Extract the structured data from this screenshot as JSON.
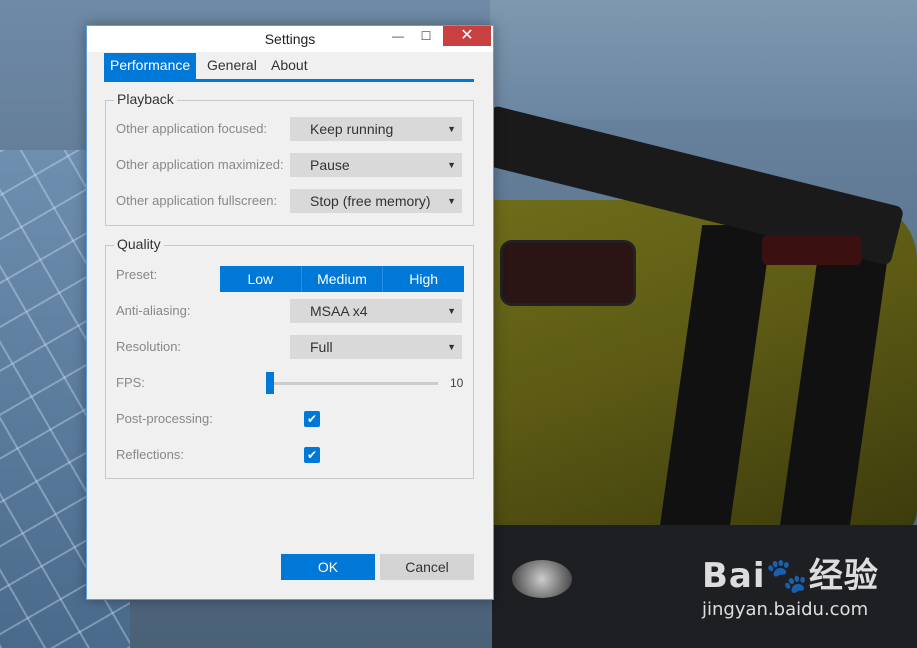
{
  "window": {
    "title": "Settings",
    "minimize_icon": "minimize-icon",
    "maximize_icon": "maximize-icon",
    "close_icon": "close-icon"
  },
  "tabs": [
    {
      "label": "Performance",
      "active": true
    },
    {
      "label": "General",
      "active": false
    },
    {
      "label": "About",
      "active": false
    }
  ],
  "playback": {
    "title": "Playback",
    "rows": [
      {
        "label": "Other application focused:",
        "value": "Keep running"
      },
      {
        "label": "Other application maximized:",
        "value": "Pause"
      },
      {
        "label": "Other application fullscreen:",
        "value": "Stop (free memory)"
      }
    ]
  },
  "quality": {
    "title": "Quality",
    "preset_label": "Preset:",
    "preset_options": [
      "Low",
      "Medium",
      "High"
    ],
    "antialiasing_label": "Anti-aliasing:",
    "antialiasing_value": "MSAA x4",
    "resolution_label": "Resolution:",
    "resolution_value": "Full",
    "fps_label": "FPS:",
    "fps_value": "10",
    "postprocessing_label": "Post-processing:",
    "postprocessing_checked": true,
    "reflections_label": "Reflections:",
    "reflections_checked": true
  },
  "buttons": {
    "ok": "OK",
    "cancel": "Cancel"
  },
  "watermark": {
    "line1": "Bai🐾经验",
    "line2": "jingyan.baidu.com"
  },
  "colors": {
    "accent": "#0078d7",
    "close": "#c84040"
  }
}
